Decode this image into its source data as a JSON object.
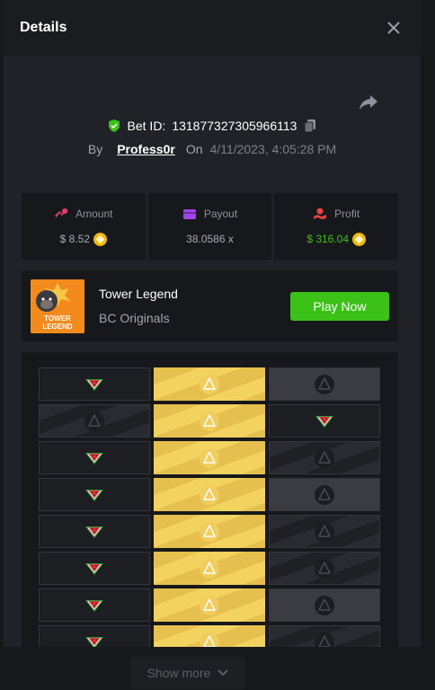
{
  "modal": {
    "title": "Details",
    "bet_label": "Bet ID:",
    "bet_id": "131877327305966113",
    "by_label": "By",
    "username": "Profess0r",
    "on_label": "On",
    "date": "4/11/2023, 4:05:28 PM"
  },
  "stats": {
    "amount": {
      "label": "Amount",
      "value": "$ 8.52"
    },
    "payout": {
      "label": "Payout",
      "value": "38.0586 x"
    },
    "profit": {
      "label": "Profit",
      "value": "$ 316.04"
    }
  },
  "game": {
    "name": "Tower Legend",
    "provider": "BC Originals",
    "play_label": "Play Now",
    "thumb_text_1": "TOWER",
    "thumb_text_2": "LEGEND"
  },
  "board": {
    "rows": [
      [
        "watermelon",
        "gold",
        "hidden"
      ],
      [
        "hidden",
        "gold",
        "watermelon"
      ],
      [
        "watermelon",
        "gold",
        "hidden"
      ],
      [
        "watermelon",
        "gold",
        "hidden"
      ],
      [
        "watermelon",
        "gold",
        "hidden"
      ],
      [
        "watermelon",
        "gold",
        "hidden"
      ],
      [
        "watermelon",
        "gold",
        "hidden"
      ],
      [
        "watermelon",
        "gold",
        "hidden"
      ]
    ]
  },
  "footer": {
    "show_more_label": "Show more"
  },
  "colors": {
    "accent_green": "#3bc117",
    "gold": "#e6c04f",
    "background": "#202227"
  }
}
